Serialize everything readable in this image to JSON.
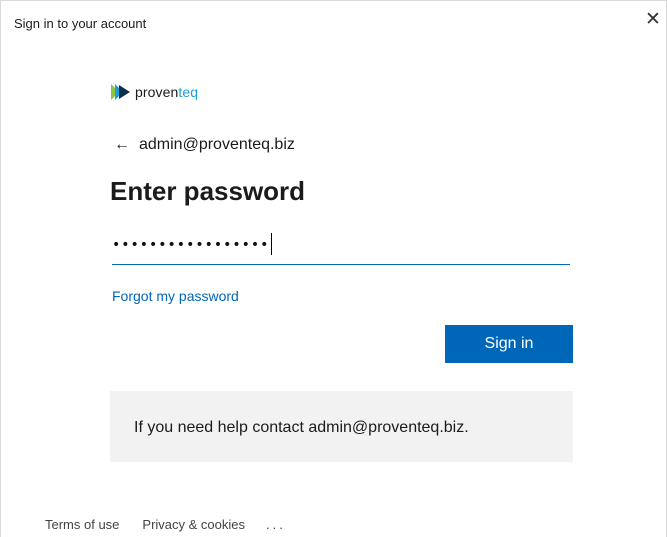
{
  "window": {
    "title": "Sign in to your account"
  },
  "logo": {
    "text_a": "proven",
    "text_b": "teq"
  },
  "identity": {
    "back_arrow": "←",
    "email": "admin@proventeq.biz"
  },
  "form": {
    "heading": "Enter password",
    "password_value": "•••••••••••••••••",
    "forgot_label": "Forgot my password",
    "signin_label": "Sign in",
    "accent_color": "#0067b8"
  },
  "help": {
    "text": "If you need help contact admin@proventeq.biz."
  },
  "footer": {
    "terms": "Terms of use",
    "privacy": "Privacy & cookies",
    "more": "..."
  }
}
